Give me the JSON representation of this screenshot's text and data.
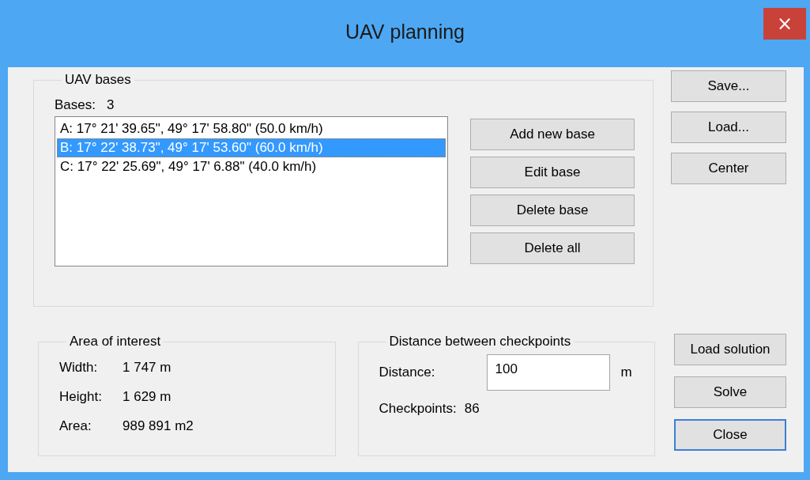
{
  "window": {
    "title": "UAV planning",
    "close": "×"
  },
  "bases_group": {
    "title": "UAV bases",
    "count_label": "Bases:",
    "count": "3",
    "items": [
      {
        "text": "A: 17° 21' 39.65\", 49° 17' 58.80\" (50.0 km/h)",
        "selected": false
      },
      {
        "text": "B: 17° 22' 38.73\", 49° 17' 53.60\" (60.0 km/h)",
        "selected": true
      },
      {
        "text": "C: 17° 22' 25.69\", 49° 17' 6.88\" (40.0 km/h)",
        "selected": false
      }
    ],
    "buttons": [
      "Add new base",
      "Edit base",
      "Delete base",
      "Delete all"
    ]
  },
  "side_buttons": [
    "Save...",
    "Load...",
    "Center"
  ],
  "area_group": {
    "title": "Area of interest",
    "rows": [
      {
        "label": "Width:",
        "value": "1 747 m"
      },
      {
        "label": "Height:",
        "value": "1 629 m"
      },
      {
        "label": "Area:",
        "value": "989 891 m2"
      }
    ]
  },
  "distance_group": {
    "title": "Distance between checkpoints",
    "distance_label": "Distance:",
    "distance_value": "100",
    "unit": "m",
    "checkpoints_label": "Checkpoints:",
    "checkpoints_value": "86"
  },
  "bottom_buttons": [
    {
      "label": "Load solution",
      "default": false
    },
    {
      "label": "Solve",
      "default": false
    },
    {
      "label": "Close",
      "default": true
    }
  ]
}
